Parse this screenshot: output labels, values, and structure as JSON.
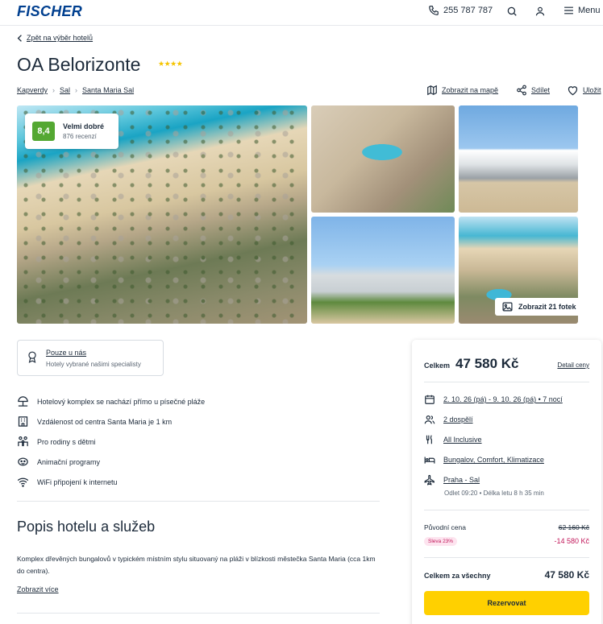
{
  "header": {
    "logo": "FISCHER",
    "phone": "255 787 787",
    "menu_label": "Menu"
  },
  "back_link": "Zpět na výběr hotelů",
  "hotel": {
    "name": "OA Belorizonte",
    "stars": 4,
    "stars_text": "★★★★"
  },
  "breadcrumb": [
    "Kapverdy",
    "Sal",
    "Santa Maria Sal"
  ],
  "actions": {
    "map": "Zobrazit na mapě",
    "share": "Sdílet",
    "save": "Uložit"
  },
  "rating": {
    "score": "8,4",
    "label": "Velmi dobré",
    "reviews": "876 recenzí",
    "color": "#54a832"
  },
  "gallery": {
    "show_photos": "Zobrazit 21 fotek"
  },
  "badge": {
    "title": "Pouze u nás",
    "subtitle": "Hotely vybrané našimi specialisty"
  },
  "features": [
    {
      "icon": "beach-umbrella-icon",
      "text": "Hotelový komplex se nachází přímo u písečné pláže"
    },
    {
      "icon": "building-icon",
      "text": "Vzdálenost od centra Santa Maria je 1 km"
    },
    {
      "icon": "family-icon",
      "text": "Pro rodiny s dětmi"
    },
    {
      "icon": "animation-icon",
      "text": "Animační programy"
    },
    {
      "icon": "wifi-icon",
      "text": "WiFi připojení k internetu"
    }
  ],
  "description": {
    "title": "Popis hotelu a služeb",
    "text": "Komplex dřevěných bungalovů v typickém místním stylu situovaný na pláži v blízkosti městečka Santa Maria (cca 1km do centra).",
    "more": "Zobrazit více"
  },
  "booking": {
    "total_label": "Celkem",
    "total_price": "47 580 Kč",
    "detail_link": "Detail ceny",
    "date": "2. 10. 26 (pá) - 9. 10. 26 (pá) • 7 nocí",
    "persons": "2 dospělí",
    "board": "All Inclusive",
    "room": "Bungalov, Comfort, Klimatizace",
    "flight": "Praha - Sal",
    "flight_info": "Odlet 09:20 • Délka letu 8 h 35 min",
    "original_label": "Původní cena",
    "original_price": "62 160 Kč",
    "discount_badge": "Sleva 23%",
    "discount_value": "-14 580 Kč",
    "all_label": "Celkem za všechny",
    "all_price": "47 580 Kč",
    "reserve": "Rezervovat",
    "accent": "#ffd000"
  }
}
